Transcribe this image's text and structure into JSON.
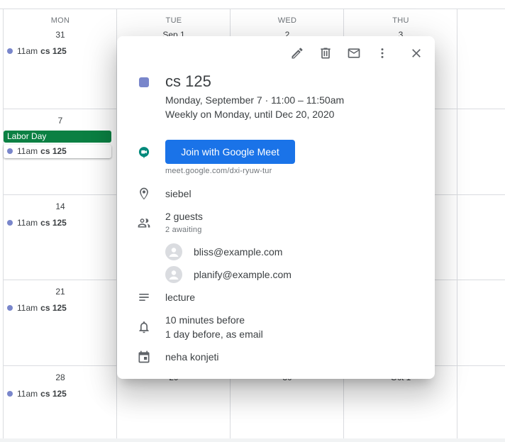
{
  "calendar": {
    "columns": [
      {
        "dow": "MON",
        "date": "31"
      },
      {
        "dow": "TUE",
        "date": "Sep 1"
      },
      {
        "dow": "WED",
        "date": "2"
      },
      {
        "dow": "THU",
        "date": "3"
      }
    ],
    "monday_dates": [
      "7",
      "14",
      "21",
      "28"
    ],
    "event_time": "11am",
    "event_title": "cs 125",
    "all_day_event": "Labor Day",
    "row5_partial_dates": [
      "29",
      "30",
      "Oct 1"
    ],
    "colors": {
      "event_dot": "#7986cb",
      "labor_day": "#0b8043"
    }
  },
  "popup": {
    "toolbar": {
      "edit": "pencil-icon",
      "delete": "trash-icon",
      "email": "mail-icon",
      "more": "more-vert-icon",
      "close": "close-icon"
    },
    "title": "cs 125",
    "date_line": "Monday, September 7   ·   11:00 – 11:50am",
    "recurrence": "Weekly on Monday, until Dec 20, 2020",
    "meet_button": "Join with Google Meet",
    "meet_link": "meet.google.com/dxi-ryuw-tur",
    "location": "siebel",
    "guests_count": "2 guests",
    "guests_status": "2 awaiting",
    "guests": [
      "bliss@example.com",
      "planify@example.com"
    ],
    "description": "lecture",
    "reminders": [
      "10 minutes before",
      "1 day before, as email"
    ],
    "organizer": "neha konjeti",
    "colors": {
      "accent": "#1a73e8",
      "swatch": "#7986cb"
    }
  }
}
